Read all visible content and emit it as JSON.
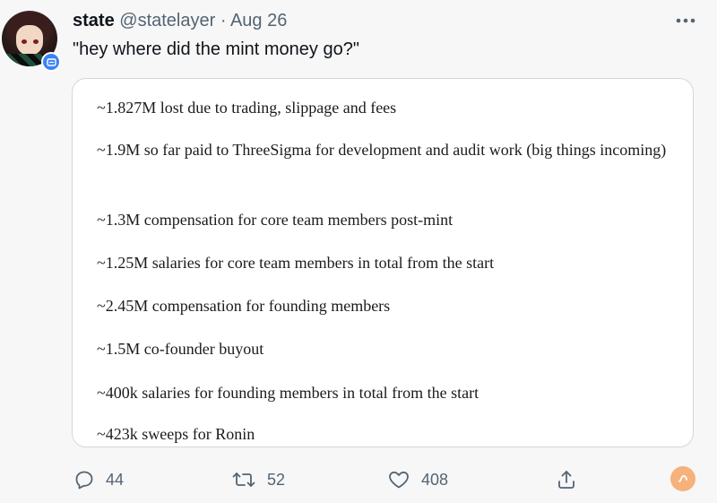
{
  "tweet": {
    "author_name": "state",
    "handle": "@statelayer",
    "separator": "·",
    "date": "Aug 26",
    "text": "\"hey where did the mint money go?\""
  },
  "card": {
    "items": [
      "~1.827M lost due to trading, slippage and fees",
      "~1.9M so far paid to ThreeSigma for development and audit work (big things incoming)",
      "~1.3M compensation for core team members post-mint",
      "~1.25M salaries for core team members in total from the start",
      "~2.45M compensation for founding members",
      "~1.5M co-founder buyout",
      "~400k salaries for founding members in total from the start",
      "~423k sweeps for Ronin"
    ]
  },
  "actions": {
    "replies": "44",
    "retweets": "52",
    "likes": "408"
  },
  "icons": {
    "more": "more-horizontal-icon",
    "reply": "reply-icon",
    "retweet": "retweet-icon",
    "like": "heart-icon",
    "share": "share-icon",
    "badge": "verified-badge-icon"
  },
  "colors": {
    "background": "#f7f7f8",
    "secondary_text": "#536471",
    "card_border": "#cfd9de",
    "badge_blue": "#3b82f6"
  }
}
